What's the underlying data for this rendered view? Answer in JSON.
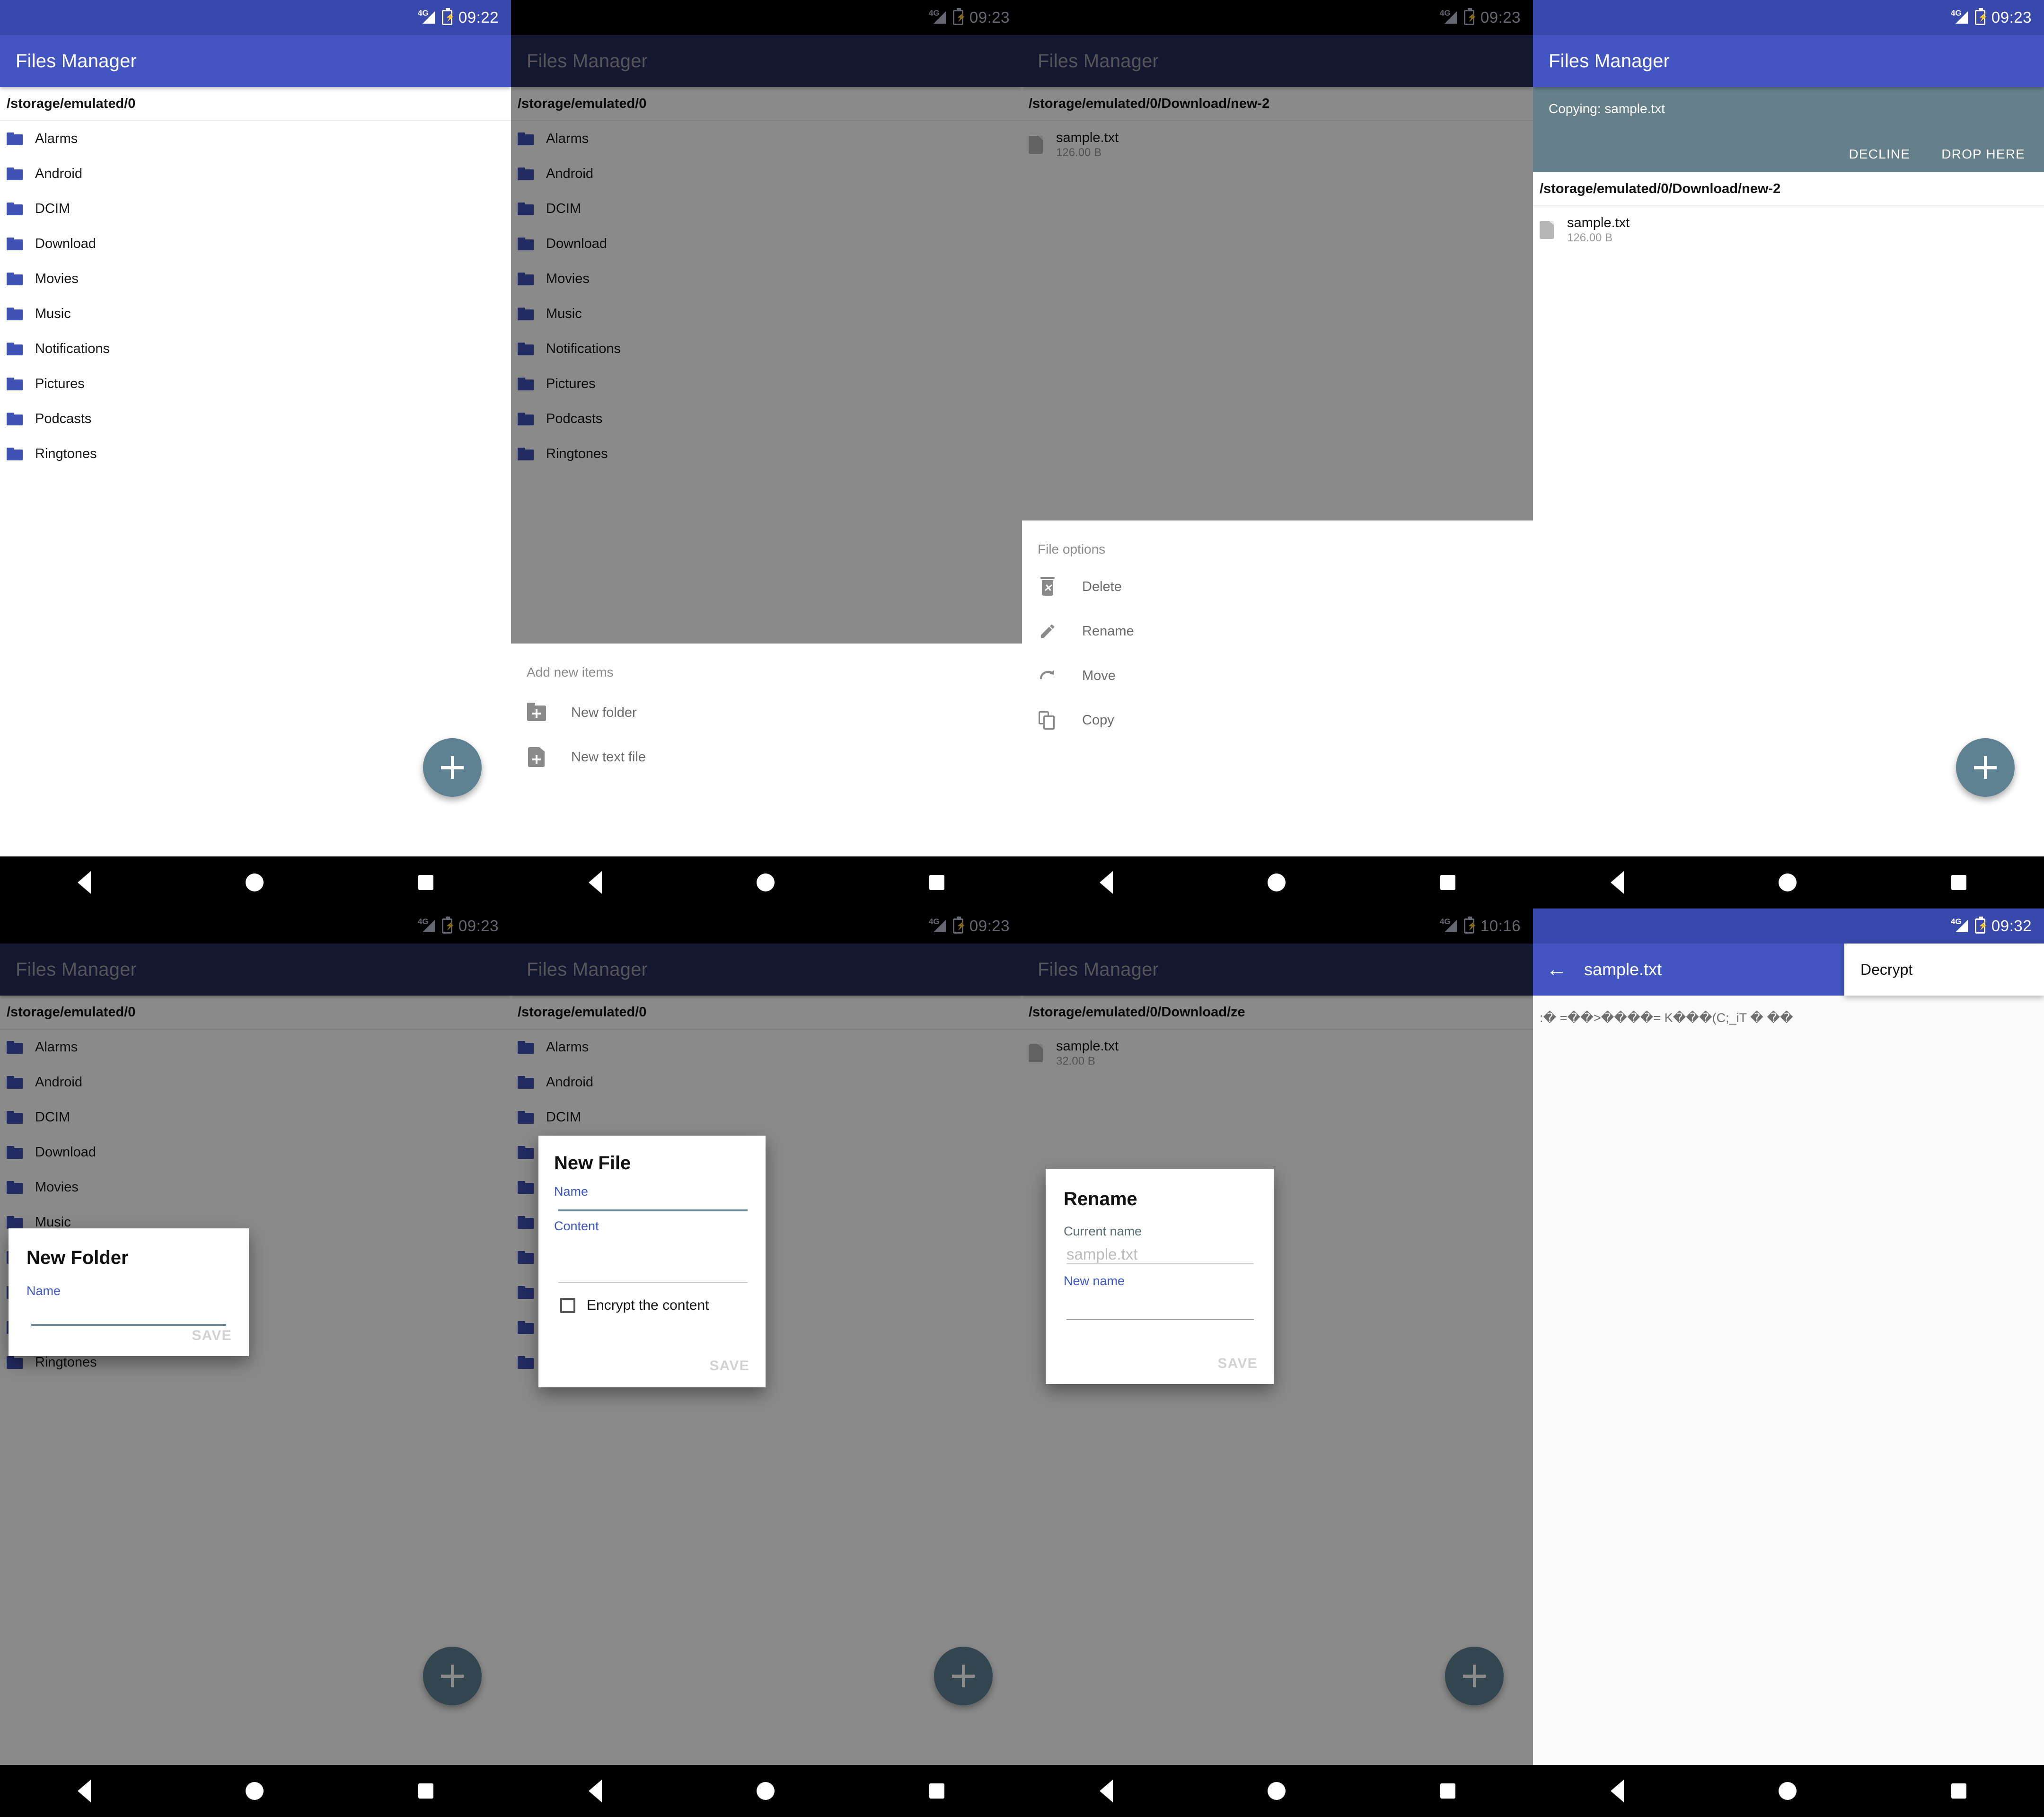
{
  "app": {
    "title": "Files Manager"
  },
  "status": {
    "network": "4G",
    "signal_icon": "signal-bars-icon",
    "battery_icon": "battery-charging-icon",
    "times": {
      "p1": "09:22",
      "p2": "09:23",
      "p3": "09:23",
      "p4": "09:23",
      "p5": "09:23",
      "p6": "09:23",
      "p7": "10:16",
      "p8": "09:32"
    }
  },
  "paths": {
    "root": "/storage/emulated/0",
    "download_new2": "/storage/emulated/0/Download/new-2",
    "download_ze": "/storage/emulated/0/Download/ze"
  },
  "folders": [
    {
      "name": "Alarms"
    },
    {
      "name": "Android"
    },
    {
      "name": "DCIM"
    },
    {
      "name": "Download"
    },
    {
      "name": "Movies"
    },
    {
      "name": "Music"
    },
    {
      "name": "Notifications"
    },
    {
      "name": "Pictures"
    },
    {
      "name": "Podcasts"
    },
    {
      "name": "Ringtones"
    }
  ],
  "files": {
    "sample_126": {
      "name": "sample.txt",
      "size": "126.00 B"
    },
    "sample_32": {
      "name": "sample.txt",
      "size": "32.00 B"
    }
  },
  "add_sheet": {
    "header": "Add new items",
    "items": [
      {
        "label": "New folder",
        "icon": "new-folder-icon"
      },
      {
        "label": "New text file",
        "icon": "new-text-file-icon"
      }
    ]
  },
  "file_options_sheet": {
    "header": "File options",
    "items": [
      {
        "label": "Delete",
        "icon": "trash-icon"
      },
      {
        "label": "Rename",
        "icon": "pencil-icon"
      },
      {
        "label": "Move",
        "icon": "move-arrow-icon"
      },
      {
        "label": "Copy",
        "icon": "copy-icon"
      }
    ]
  },
  "copy_banner": {
    "text": "Copying: sample.txt",
    "decline_label": "DECLINE",
    "drop_label": "DROP HERE",
    "color": "#647f8a"
  },
  "new_folder_dialog": {
    "title": "New Folder",
    "name_label": "Name",
    "name_value": "",
    "save_label": "SAVE"
  },
  "new_file_dialog": {
    "title": "New File",
    "name_label": "Name",
    "name_value": "",
    "content_label": "Content",
    "content_value": "",
    "encrypt_label": "Encrypt the content",
    "encrypt_checked": false,
    "save_label": "SAVE"
  },
  "rename_dialog": {
    "title": "Rename",
    "current_label": "Current name",
    "current_value": "sample.txt",
    "new_label": "New name",
    "new_value": "",
    "save_label": "SAVE"
  },
  "decrypt_screen": {
    "back_icon": "back-arrow-icon",
    "file_title": "sample.txt",
    "menu_item": "Decrypt",
    "encrypted_content": ":� =��>����= K���(C;_iT � ��"
  },
  "fab": {
    "icon": "plus-icon",
    "color": "#5f8292"
  },
  "navbar": {
    "back": "back-triangle-icon",
    "home": "home-circle-icon",
    "recents": "recents-square-icon"
  },
  "colors": {
    "appbar": "#4355c0",
    "statusbar": "#3949ab",
    "folder": "#3f51b5",
    "accent": "#3d56c6"
  }
}
